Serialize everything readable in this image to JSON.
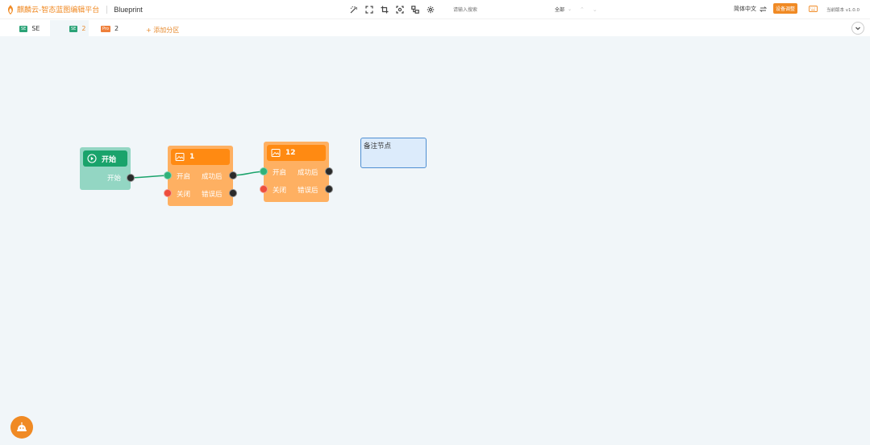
{
  "header": {
    "brand_name": "麒麟云-智态蓝图编辑平台",
    "page_name": "Blueprint",
    "toolbar_icons": [
      "magic-wand-icon",
      "expand-icon",
      "crop-icon",
      "focus-icon",
      "layout-icon",
      "gear-icon"
    ],
    "search_placeholder": "请输入搜索",
    "scope_label": "全部",
    "language_label": "简体中文",
    "device_button_label": "设备调整",
    "version_label": "当前版本 v1.0.0"
  },
  "tabs": [
    {
      "badge": "SE",
      "badge_type": "se",
      "label": "SE",
      "active": false
    },
    {
      "badge": "SE",
      "badge_type": "se",
      "label": "2",
      "active": true
    },
    {
      "badge": "Pro",
      "badge_type": "pro",
      "label": "2",
      "active": false
    }
  ],
  "add_area_label": "+ 添加分区",
  "nodes": {
    "start": {
      "title": "开始",
      "output_label": "开始"
    },
    "node1": {
      "title": "1",
      "in_on": "开启",
      "in_off": "关闭",
      "out_success": "成功后",
      "out_error": "错误后"
    },
    "node2": {
      "title": "12",
      "in_on": "开启",
      "in_off": "关闭",
      "out_success": "成功后",
      "out_error": "错误后"
    },
    "note": {
      "text": "备注节点"
    }
  },
  "colors": {
    "accent": "#f08a24",
    "start_node": "#93d6c3",
    "start_header": "#1aa36b",
    "flow_node": "#feb062",
    "flow_header": "#ff8a12",
    "wire": "#1aa36b",
    "note_border": "#4f8fd2",
    "note_fill": "#dcebfb"
  }
}
